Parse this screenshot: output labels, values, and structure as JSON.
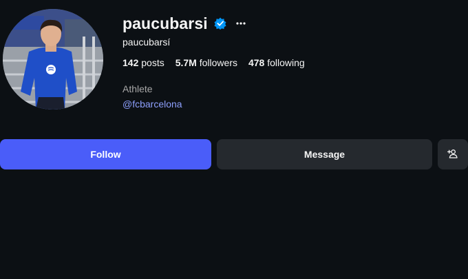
{
  "profile": {
    "username": "paucubarsi",
    "full_name": "paucubarsí",
    "category": "Athlete",
    "link": "@fcbarcelona",
    "verified": true
  },
  "stats": {
    "posts_count": "142",
    "posts_label": " posts",
    "followers_count": "5.7M",
    "followers_label": " followers",
    "following_count": "478",
    "following_label": " following"
  },
  "actions": {
    "follow_label": "Follow",
    "message_label": "Message",
    "suggest_icon": "add-person-icon",
    "more_icon": "more-horizontal-icon"
  },
  "colors": {
    "background": "#0c1014",
    "follow_button": "#4a5df9",
    "secondary_button": "#25292e",
    "verified_badge": "#0095f6",
    "link": "#8d9ffc"
  }
}
